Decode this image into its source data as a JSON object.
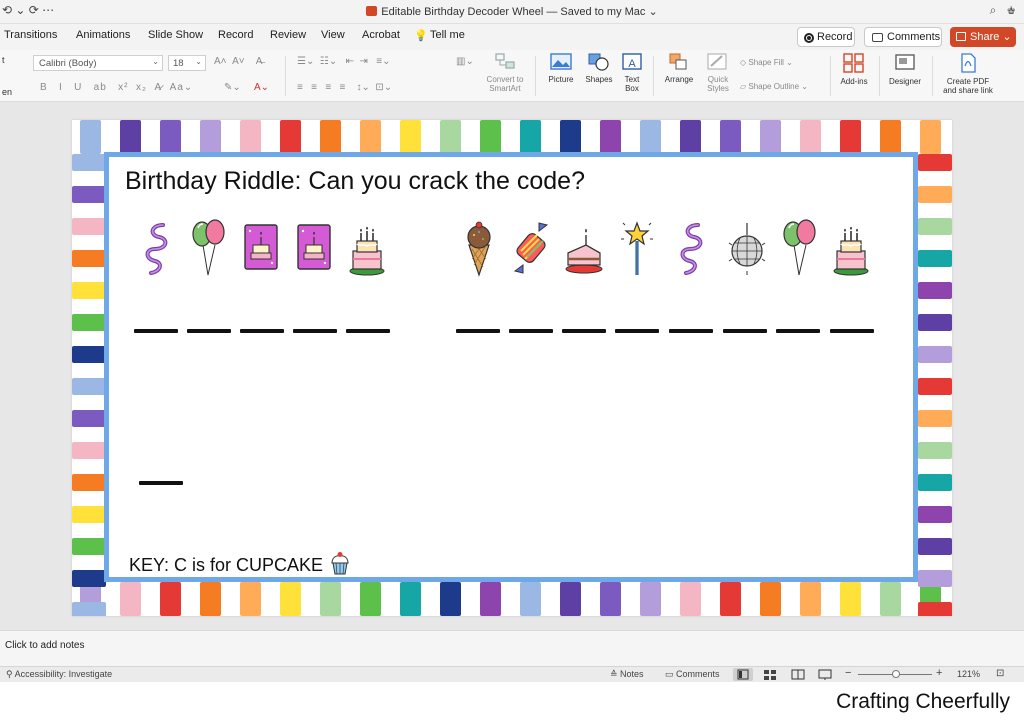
{
  "window": {
    "document_title": "Editable Birthday Decoder Wheel",
    "save_status": "— Saved to my Mac"
  },
  "tabs": [
    "Transitions",
    "Animations",
    "Slide Show",
    "Record",
    "Review",
    "View",
    "Acrobat"
  ],
  "tell_me": "Tell me",
  "header_buttons": {
    "record": "Record",
    "comments": "Comments",
    "share": "Share"
  },
  "ribbon": {
    "font_name": "Calibri (Body)",
    "font_size": "18",
    "convert_smartart": [
      "Convert to",
      "SmartArt"
    ],
    "picture": "Picture",
    "shapes": "Shapes",
    "text_box": [
      "Text",
      "Box"
    ],
    "arrange": "Arrange",
    "quick_styles": [
      "Quick",
      "Styles"
    ],
    "shape_fill": "Shape Fill",
    "shape_outline": "Shape Outline",
    "add_ins": "Add-ins",
    "designer": "Designer",
    "create_pdf": [
      "Create PDF",
      "and share link"
    ],
    "left_cut_labels": [
      "t",
      "en"
    ]
  },
  "slide": {
    "title": "Birthday Riddle: Can you crack the code?",
    "word1_icons": [
      "streamer",
      "balloons",
      "birthday-card",
      "birthday-card",
      "birthday-cake"
    ],
    "word2_icons": [
      "ice-cream-cone",
      "candy",
      "cake-slice",
      "magic-wand",
      "streamer",
      "disco-ball",
      "balloons",
      "birthday-cake"
    ],
    "word1_blank_count": 5,
    "word2_blank_count": 8,
    "word3_blank_count": 1,
    "key_text": "KEY: C is for CUPCAKE",
    "stripe_colors": [
      "#9bb7e4",
      "#5e3fa3",
      "#7c5bc0",
      "#b39ddb",
      "#f4b6c2",
      "#e53935",
      "#f57c22",
      "#ffab57",
      "#ffe13a",
      "#a8d8a0",
      "#5cc04a",
      "#16a6a6",
      "#1e3a8a",
      "#8e44ad"
    ]
  },
  "notes_placeholder": "Click to add notes",
  "status": {
    "accessibility": "Accessibility: Investigate",
    "notes": "Notes",
    "comments": "Comments",
    "zoom": "121%"
  },
  "watermark": "Crafting Cheerfully"
}
